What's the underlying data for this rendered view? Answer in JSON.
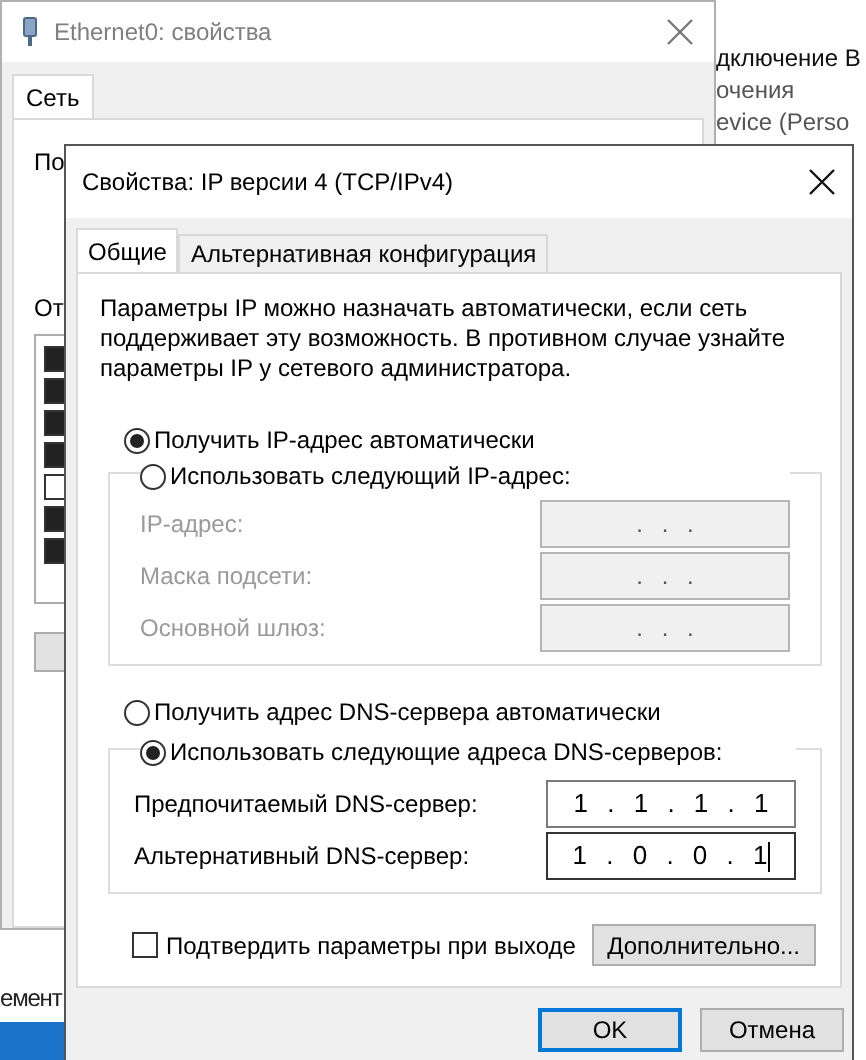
{
  "explorer": {
    "lines": [
      "дключение В",
      "очения",
      "evice (Perso"
    ],
    "status_text": "емент"
  },
  "background_window": {
    "title": "Ethernet0: свойства",
    "tabs": [
      {
        "label": "Сеть",
        "selected": true
      }
    ],
    "label_1": "По",
    "label_2": "От",
    "components": [
      {
        "checked": true
      },
      {
        "checked": true
      },
      {
        "checked": true
      },
      {
        "checked": true
      },
      {
        "checked": false
      },
      {
        "checked": true
      },
      {
        "checked": true
      }
    ]
  },
  "dialog": {
    "title": "Свойства: IP версии 4 (TCP/IPv4)",
    "tabs": [
      {
        "label": "Общие",
        "selected": true
      },
      {
        "label": "Альтернативная конфигурация",
        "selected": false
      }
    ],
    "description": "Параметры IP можно назначать автоматически, если сеть поддерживает эту возможность. В противном случае узнайте параметры IP у сетевого администратора.",
    "ip_options": [
      {
        "label": "Получить IP-адрес автоматически",
        "selected": true
      },
      {
        "label": "Использовать следующий IP-адрес:",
        "selected": false
      }
    ],
    "ip_fields": [
      {
        "label": "IP-адрес:",
        "value": ". . .",
        "disabled": true,
        "focused": false
      },
      {
        "label": "Маска подсети:",
        "value": ". . .",
        "disabled": true,
        "focused": false
      },
      {
        "label": "Основной шлюз:",
        "value": ". . .",
        "disabled": true,
        "focused": false
      }
    ],
    "dns_options": [
      {
        "label": "Получить адрес DNS-сервера автоматически",
        "selected": false
      },
      {
        "label": "Использовать следующие адреса DNS-серверов:",
        "selected": true
      }
    ],
    "dns_fields": [
      {
        "label": "Предпочитаемый DNS-сервер:",
        "value": "1 . 1 . 1 . 1",
        "disabled": false,
        "focused": false
      },
      {
        "label": "Альтернативный DNS-сервер:",
        "value": "1 . 0 . 0 . 1",
        "disabled": false,
        "focused": true
      }
    ],
    "validate_checkbox": {
      "label": "Подтвердить параметры при выходе",
      "checked": false
    },
    "advanced_button": "Дополнительно...",
    "buttons": [
      {
        "label": "OK",
        "default": true
      },
      {
        "label": "Отмена",
        "default": false
      }
    ]
  }
}
